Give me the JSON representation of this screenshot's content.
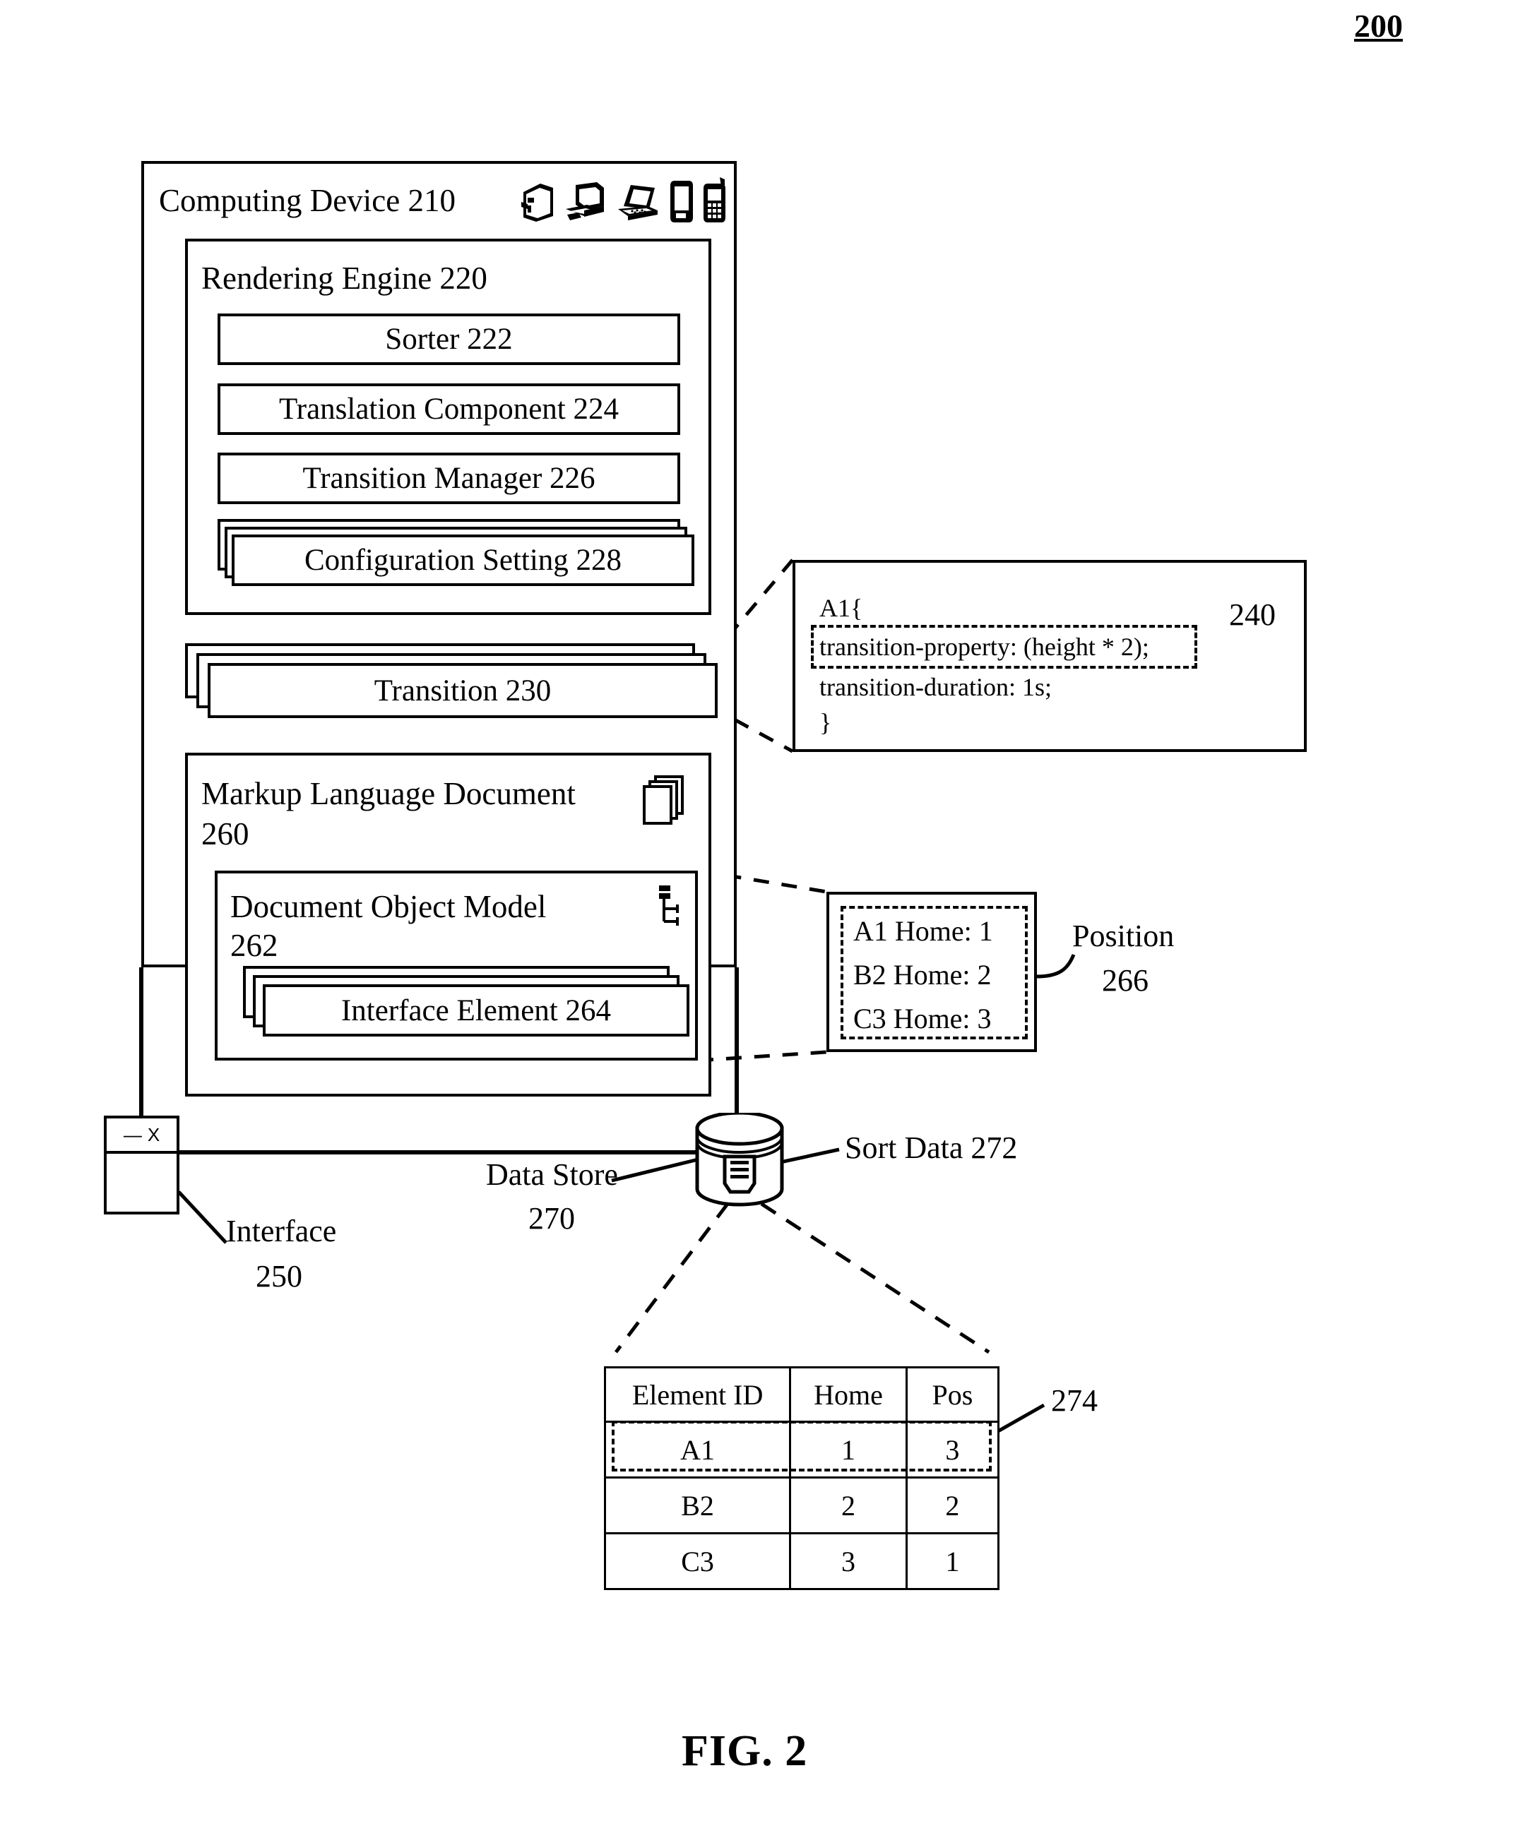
{
  "figure": {
    "number_label": "200",
    "caption": "FIG. 2"
  },
  "computing_device": {
    "title": "Computing Device 210",
    "device_icons": [
      "server-tower-icon",
      "desktop-computer-icon",
      "laptop-icon",
      "tablet-icon",
      "mobile-phone-icon"
    ]
  },
  "rendering_engine": {
    "title": "Rendering Engine 220",
    "components": [
      {
        "label": "Sorter 222",
        "name": "sorter-box"
      },
      {
        "label": "Translation Component 224",
        "name": "translation-component-box"
      },
      {
        "label": "Transition Manager 226",
        "name": "transition-manager-box"
      },
      {
        "label": "Configuration Setting 228",
        "name": "configuration-setting-box"
      }
    ]
  },
  "transition": {
    "label": "Transition 230"
  },
  "css_callout": {
    "ref": "240",
    "lines": [
      "A1{",
      "transition-property: (height * 2);",
      "transition-duration: 1s;",
      "}"
    ],
    "highlighted_line_index": 1
  },
  "markup_document": {
    "title_line1": "Markup Language Document",
    "title_line2": "260",
    "icon": "stacked-pages-icon"
  },
  "dom": {
    "title_line1": "Document Object Model",
    "title_line2": "262",
    "icon": "dom-tree-icon",
    "interface_element_label": "Interface Element 264"
  },
  "position_callout": {
    "ref_line1": "Position",
    "ref_line2": "266",
    "entries": [
      "A1 Home: 1",
      "B2 Home: 2",
      "C3 Home: 3"
    ]
  },
  "interface": {
    "ref_line1": "Interface",
    "ref_line2": "250",
    "titlebar_minimize": "—",
    "titlebar_close": "X"
  },
  "data_store": {
    "ref_line1": "Data Store",
    "ref_line2": "270",
    "icon": "database-cylinder-icon"
  },
  "sort_data": {
    "label": "Sort Data 272"
  },
  "sort_table": {
    "ref": "274",
    "headers": [
      "Element ID",
      "Home",
      "Pos"
    ],
    "rows": [
      [
        "A1",
        "1",
        "3"
      ],
      [
        "B2",
        "2",
        "2"
      ],
      [
        "C3",
        "3",
        "1"
      ]
    ],
    "highlighted_row_index": 0
  }
}
